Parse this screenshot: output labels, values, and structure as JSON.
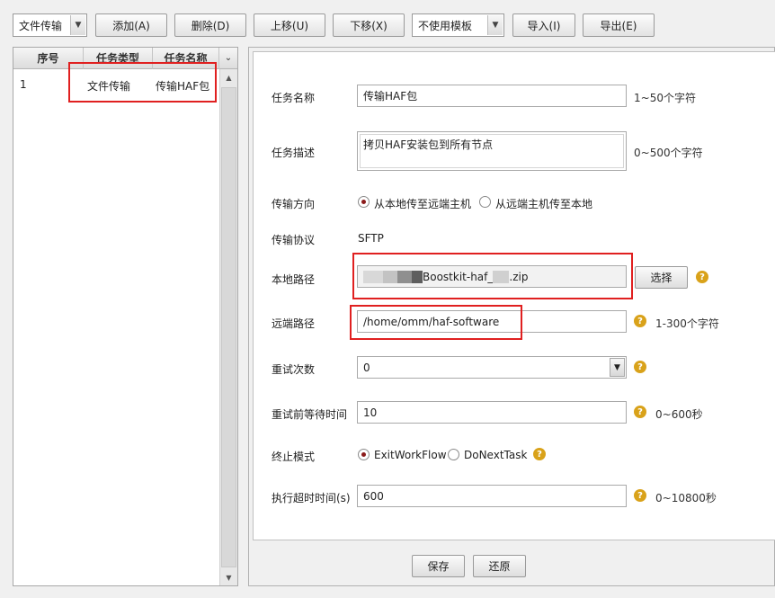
{
  "toolbar": {
    "type_select": "文件传输",
    "add": "添加(A)",
    "delete": "删除(D)",
    "move_up": "上移(U)",
    "move_down": "下移(X)",
    "template_select": "不使用模板",
    "import": "导入(I)",
    "export": "导出(E)"
  },
  "task_list": {
    "columns": [
      "序号",
      "任务类型",
      "任务名称"
    ],
    "rows": [
      {
        "index": "1",
        "type": "文件传输",
        "name": "传输HAF包"
      }
    ]
  },
  "form": {
    "task_name": {
      "label": "任务名称",
      "value": "传输HAF包",
      "hint": "1~50个字符"
    },
    "task_desc": {
      "label": "任务描述",
      "value": "拷贝HAF安装包到所有节点",
      "hint": "0~500个字符"
    },
    "direction": {
      "label": "传输方向",
      "option1": "从本地传至远端主机",
      "option2": "从远端主机传至本地",
      "selected": "option1"
    },
    "protocol": {
      "label": "传输协议",
      "value": "SFTP"
    },
    "local_path": {
      "label": "本地路径",
      "value_suffix": "Boostkit-haf_",
      "value_ext": ".zip",
      "button": "选择"
    },
    "remote_path": {
      "label": "远端路径",
      "value": "/home/omm/haf-software",
      "hint": "1-300个字符"
    },
    "retry_count": {
      "label": "重试次数",
      "value": "0"
    },
    "retry_wait": {
      "label": "重试前等待时间",
      "value": "10",
      "hint": "0~600秒"
    },
    "stop_mode": {
      "label": "终止模式",
      "option1": "ExitWorkFlow",
      "option2": "DoNextTask",
      "selected": "option1"
    },
    "timeout": {
      "label": "执行超时时间(s)",
      "value": "600",
      "hint": "0~10800秒"
    }
  },
  "footer": {
    "save": "保存",
    "restore": "还原"
  },
  "colors": {
    "highlight_box": "#e02020",
    "help_icon": "#d9a21a"
  }
}
